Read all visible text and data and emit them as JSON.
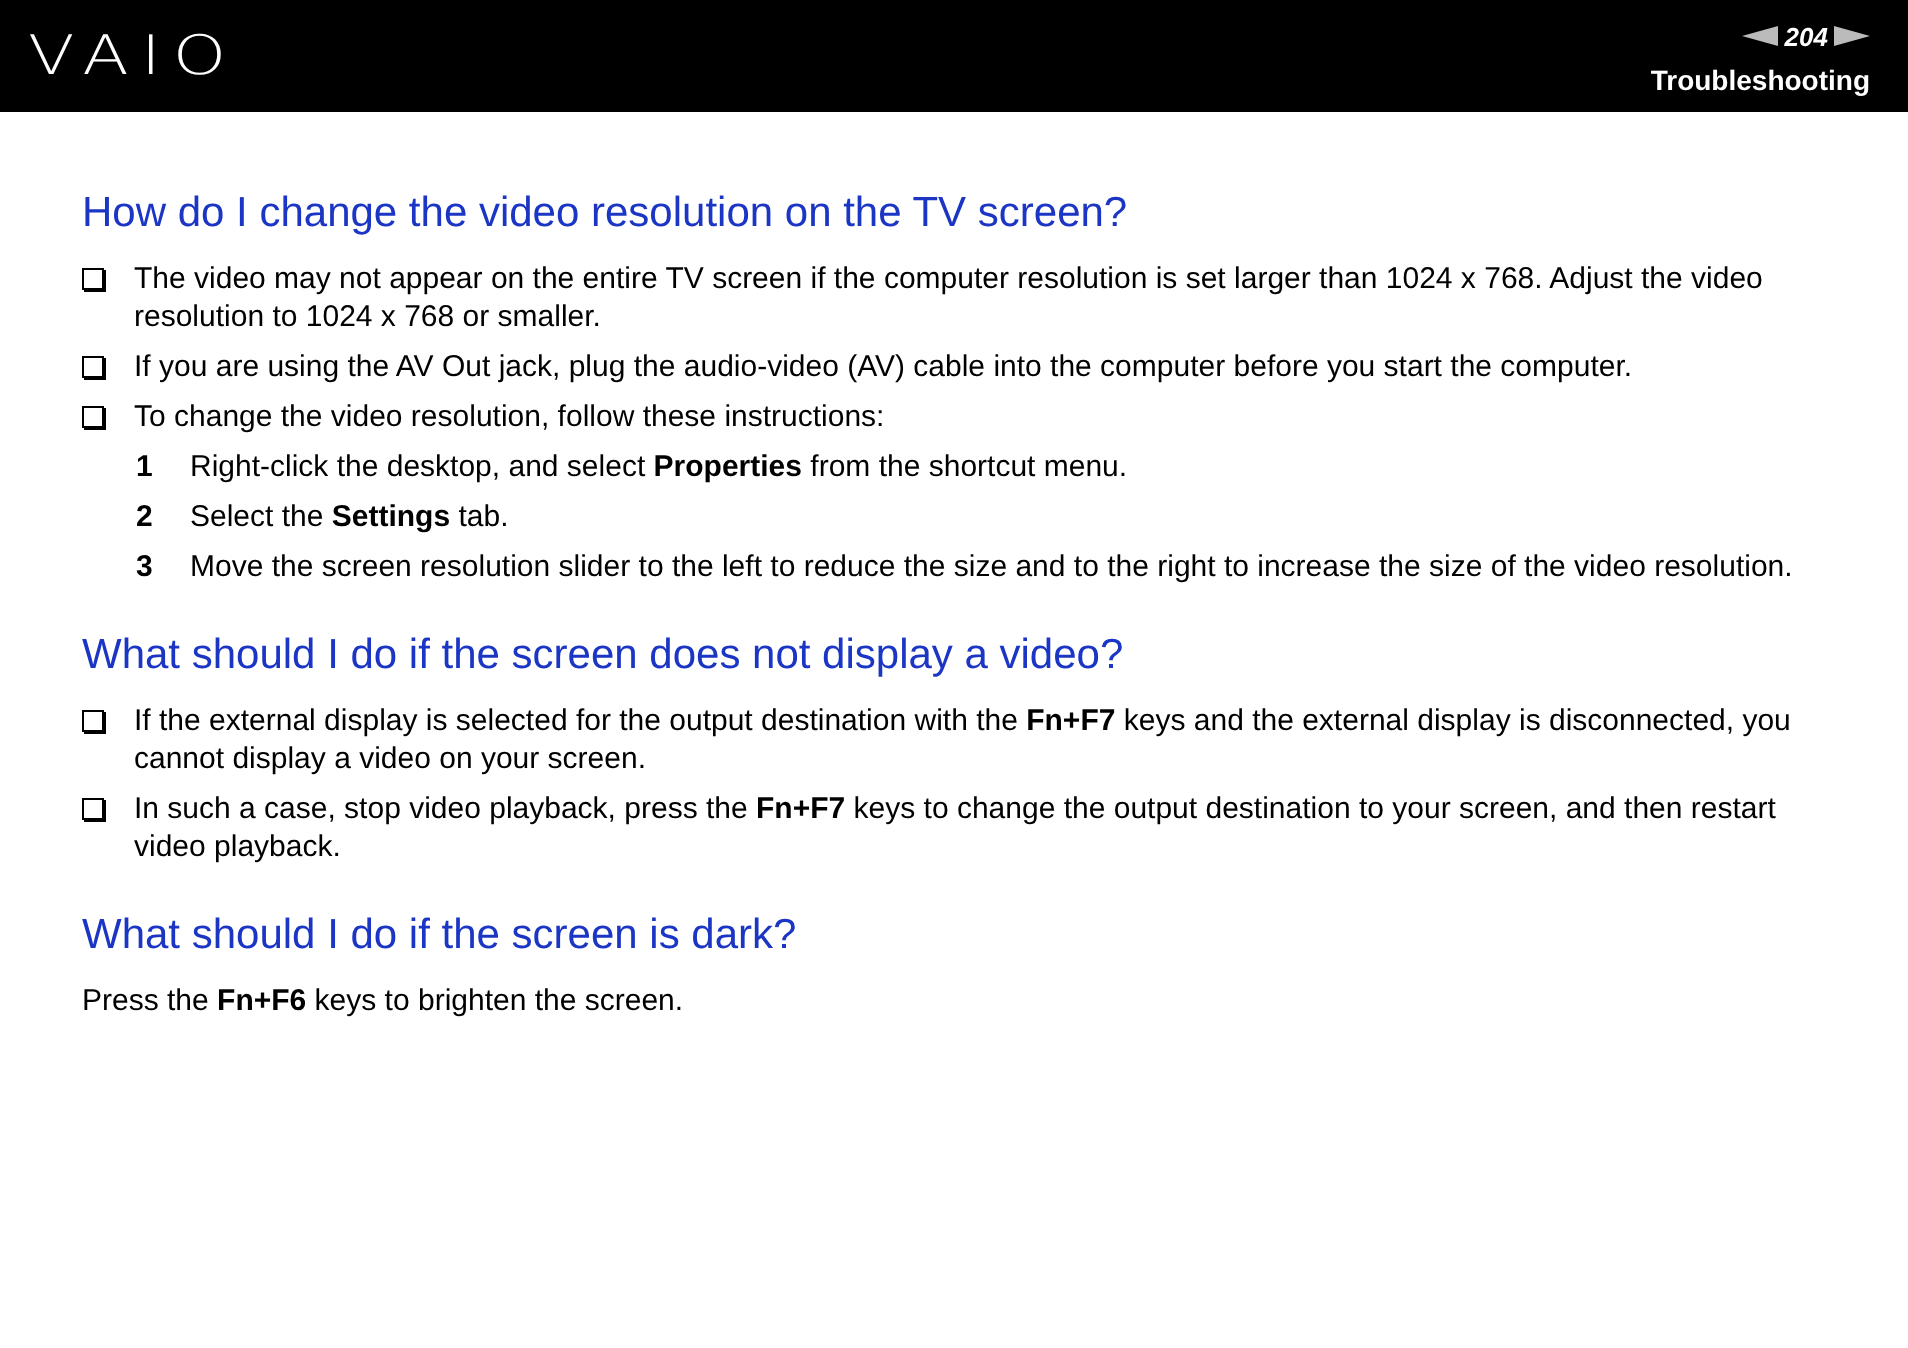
{
  "header": {
    "logo": "VAIO",
    "page_number": "204",
    "section": "Troubleshooting"
  },
  "sections": [
    {
      "heading": "How do I change the video resolution on the TV screen?",
      "items": [
        {
          "kind": "bullet",
          "text": "The video may not appear on the entire TV screen if the computer resolution is set larger than 1024 x 768. Adjust the video resolution to 1024 x 768 or smaller."
        },
        {
          "kind": "bullet",
          "text": "If you are using the AV Out jack, plug the audio-video (AV) cable into the computer before you start the computer."
        },
        {
          "kind": "bullet",
          "text": "To change the video resolution, follow these instructions:"
        },
        {
          "kind": "step",
          "number": "1",
          "text": "Right-click the desktop, and select **Properties** from the shortcut menu."
        },
        {
          "kind": "step",
          "number": "2",
          "text": "Select the **Settings** tab."
        },
        {
          "kind": "step",
          "number": "3",
          "text": "Move the screen resolution slider to the left to reduce the size and to the right to increase the size of the video resolution."
        }
      ]
    },
    {
      "heading": "What should I do if the screen does not display a video?",
      "items": [
        {
          "kind": "bullet",
          "text": "If the external display is selected for the output destination with the **Fn+F7** keys and the external display is disconnected, you cannot display a video on your screen."
        },
        {
          "kind": "bullet",
          "text": "In such a case, stop video playback, press the **Fn+F7** keys to change the output destination to your screen, and then restart video playback."
        }
      ]
    },
    {
      "heading": "What should I do if the screen is dark?",
      "items": [
        {
          "kind": "paragraph",
          "text": "Press the **Fn+F6** keys to brighten the screen."
        }
      ]
    }
  ]
}
